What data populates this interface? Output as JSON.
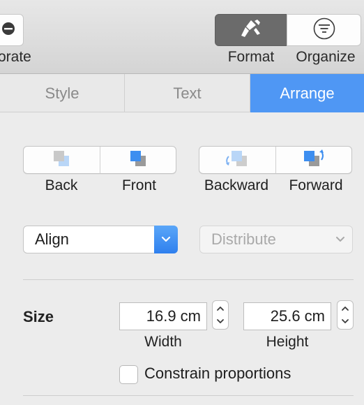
{
  "toolbar": {
    "collaborate_label": "orate",
    "format_label": "Format",
    "organize_label": "Organize"
  },
  "tabs": [
    {
      "label": "Style"
    },
    {
      "label": "Text"
    },
    {
      "label": "Arrange",
      "selected": true
    }
  ],
  "arrange": {
    "order_group1": [
      {
        "label": "Back",
        "icon": "send-to-back-icon"
      },
      {
        "label": "Front",
        "icon": "bring-to-front-icon"
      }
    ],
    "order_group2": [
      {
        "label": "Backward",
        "icon": "send-backward-icon"
      },
      {
        "label": "Forward",
        "icon": "bring-forward-icon"
      }
    ],
    "align": {
      "value": "Align"
    },
    "distribute": {
      "value": "Distribute",
      "enabled": false
    },
    "size": {
      "label": "Size",
      "width": "16.9 cm",
      "width_caption": "Width",
      "height": "25.6 cm",
      "height_caption": "Height",
      "constrain_label": "Constrain proportions",
      "constrain_checked": false
    }
  },
  "colors": {
    "accent": "#4f97f4",
    "format_active": "#6b6b6b"
  }
}
